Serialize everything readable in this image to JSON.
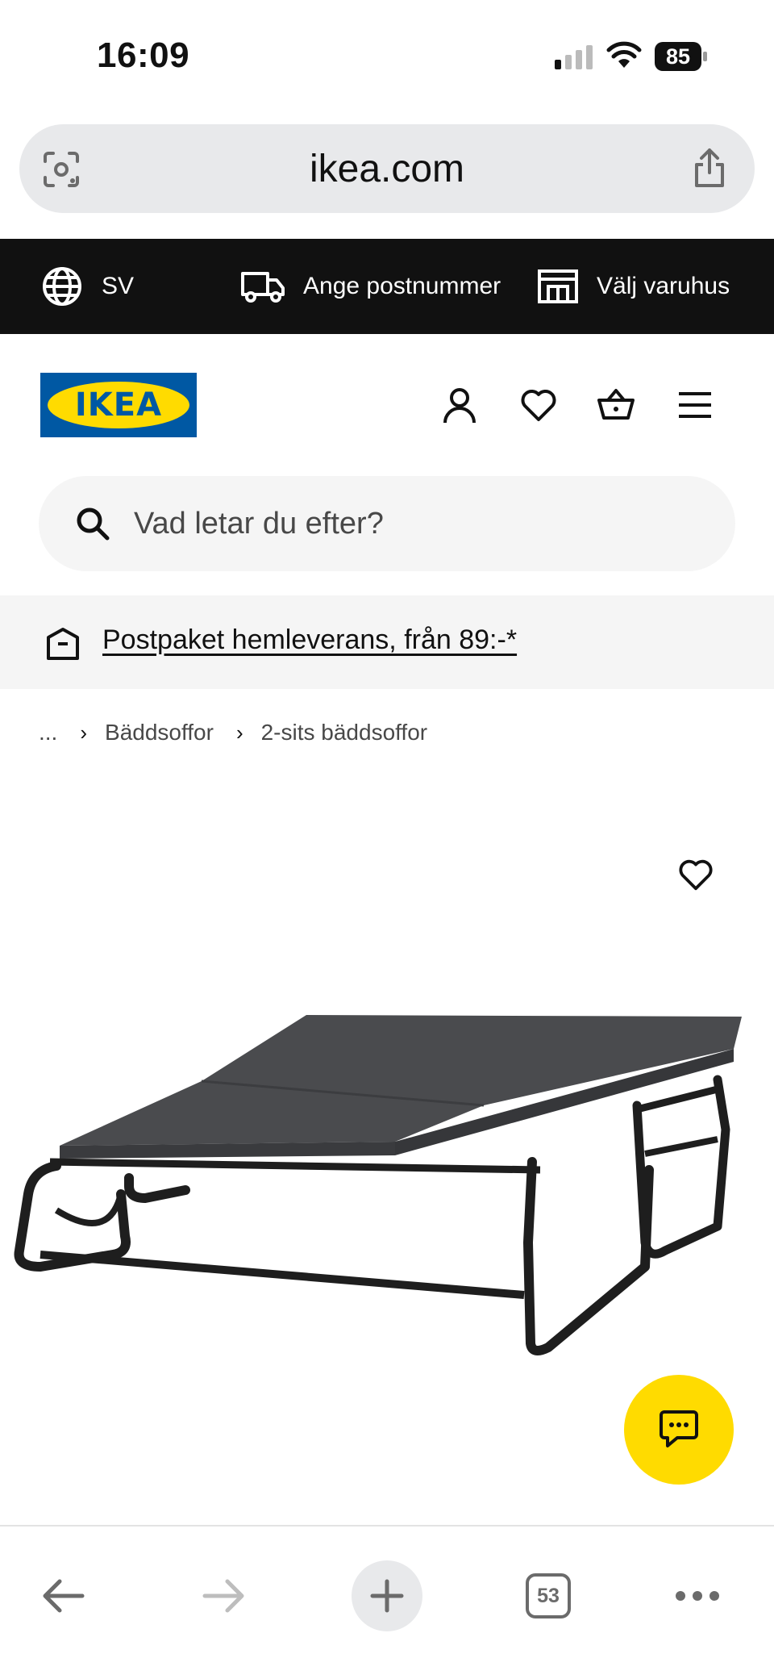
{
  "status_bar": {
    "time": "16:09",
    "battery": "85"
  },
  "browser": {
    "url": "ikea.com",
    "tab_count": "53"
  },
  "topbar": {
    "language": "SV",
    "postal_code": "Ange postnummer",
    "store": "Välj varuhus"
  },
  "header": {
    "logo_text": "IKEA",
    "icons": [
      "user-icon",
      "heart-icon",
      "basket-icon",
      "menu-icon"
    ]
  },
  "search": {
    "placeholder": "Vad letar du efter?"
  },
  "promo": {
    "text": "Postpaket hemleverans, från 89:-*"
  },
  "breadcrumb": {
    "ellipsis": "...",
    "items": [
      "Bäddsoffor",
      "2-sits bäddsoffor"
    ]
  },
  "colors": {
    "ikea_blue": "#0058a3",
    "ikea_yellow": "#ffdb00",
    "topbar_bg": "#111111",
    "banner_bg": "#f5f5f5"
  }
}
